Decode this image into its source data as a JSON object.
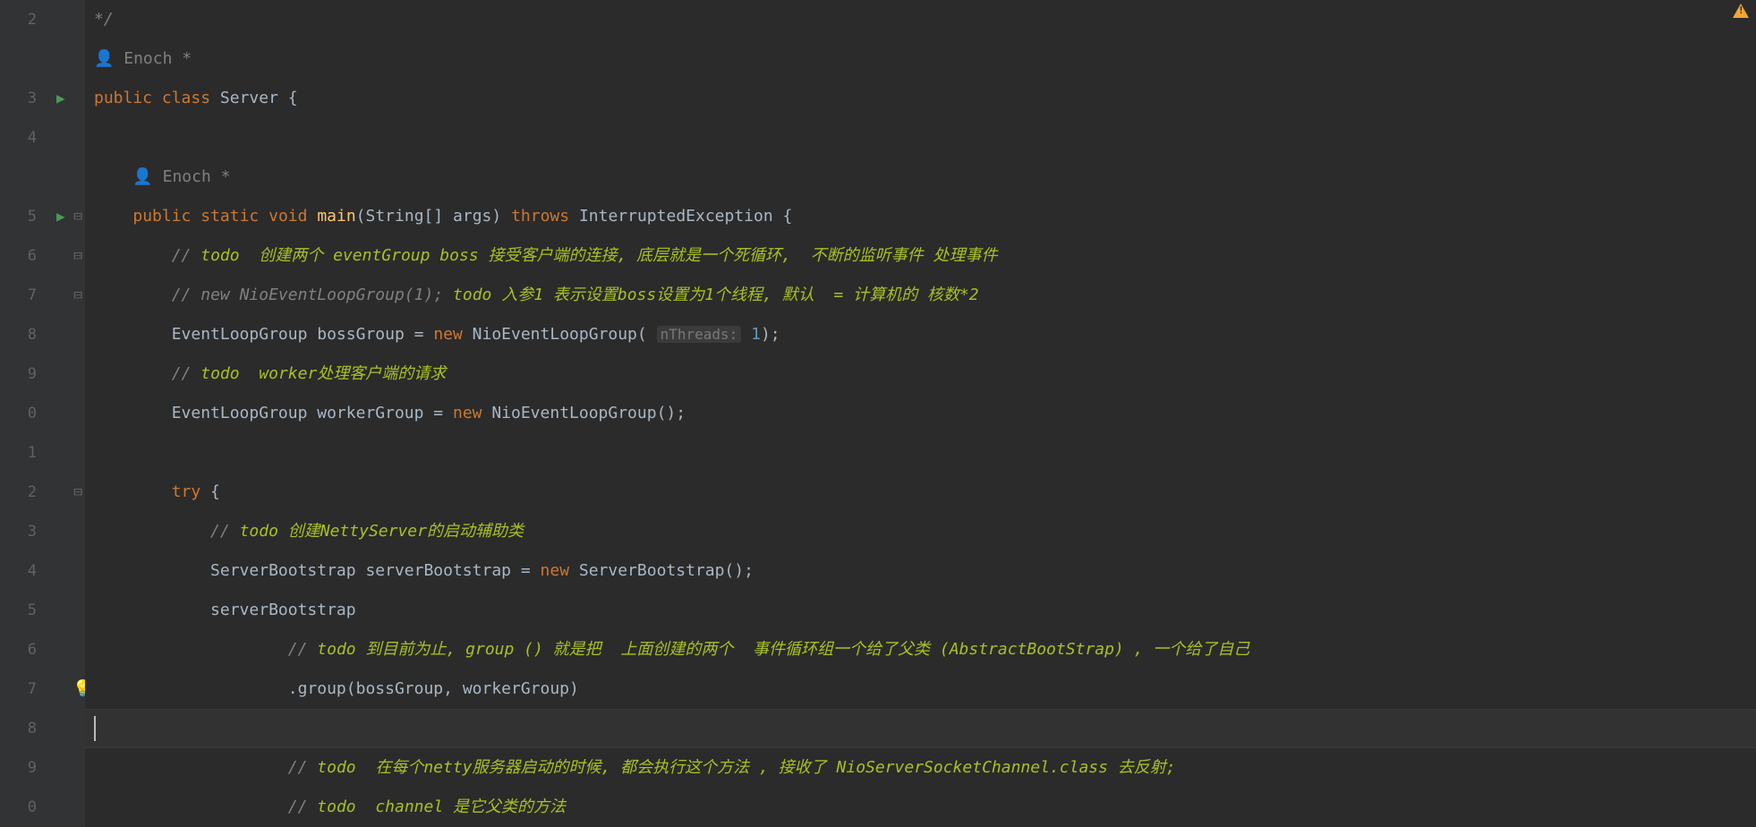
{
  "lineNumbers": [
    "2",
    "",
    "3",
    "4",
    "",
    "5",
    "6",
    "7",
    "8",
    "9",
    "0",
    "1",
    "2",
    "3",
    "4",
    "5",
    "6",
    "7",
    "8",
    "9",
    "0"
  ],
  "author1": "Enoch *",
  "author2": "Enoch *",
  "lines": {
    "l1": "*/",
    "l3_kw_public": "public",
    "l3_kw_class": "class",
    "l3_classname": "Server {",
    "l5_kw_public": "public",
    "l5_kw_static": "static",
    "l5_kw_void": "void",
    "l5_method": "main",
    "l5_params": "(String[] args)",
    "l5_kw_throws": "throws",
    "l5_exc": "InterruptedException {",
    "l6_slash": "//",
    "l6_todo": "todo",
    "l6_txt": "  创建两个 eventGroup boss 接受客户端的连接, 底层就是一个死循环,  不断的监听事件 处理事件",
    "l7_slash": "//",
    "l7_code": "new NioEventLoopGroup(1);",
    "l7_todo": "todo 入参1 表示设置boss设置为1个线程, 默认  = 计算机的 核数*2",
    "l8_txt1": "EventLoopGroup bossGroup = ",
    "l8_kw_new": "new",
    "l8_txt2": " NioEventLoopGroup( ",
    "l8_hint": "nThreads:",
    "l8_num": " 1",
    "l8_txt3": ");",
    "l9_slash": "//",
    "l9_todo": "todo",
    "l9_txt": "  worker处理客户端的请求",
    "l10_txt1": "EventLoopGroup workerGroup = ",
    "l10_kw_new": "new",
    "l10_txt2": " NioEventLoopGroup();",
    "l12_kw_try": "try",
    "l12_brace": " {",
    "l13_slash": "//",
    "l13_todo": "todo 创建NettyServer的启动辅助类",
    "l14_txt1": "ServerBootstrap serverBootstrap = ",
    "l14_kw_new": "new",
    "l14_txt2": " ServerBootstrap();",
    "l15_txt": "serverBootstrap",
    "l16_slash": "//",
    "l16_todo": "todo 到目前为止, group () 就是把  上面创建的两个  事件循环组一个给了父类 (AbstractBootStrap) , 一个给了自己",
    "l17_txt": ".group(bossGroup, workerGroup)",
    "l19_slash": "//",
    "l19_todo": "todo",
    "l19_txt": "  在每个netty服务器启动的时候, 都会执行这个方法 , 接收了 NioServerSocketChannel.class 去反射;",
    "l20_slash": "//",
    "l20_todo": "todo",
    "l20_txt": "  channel 是它父类的方法"
  }
}
